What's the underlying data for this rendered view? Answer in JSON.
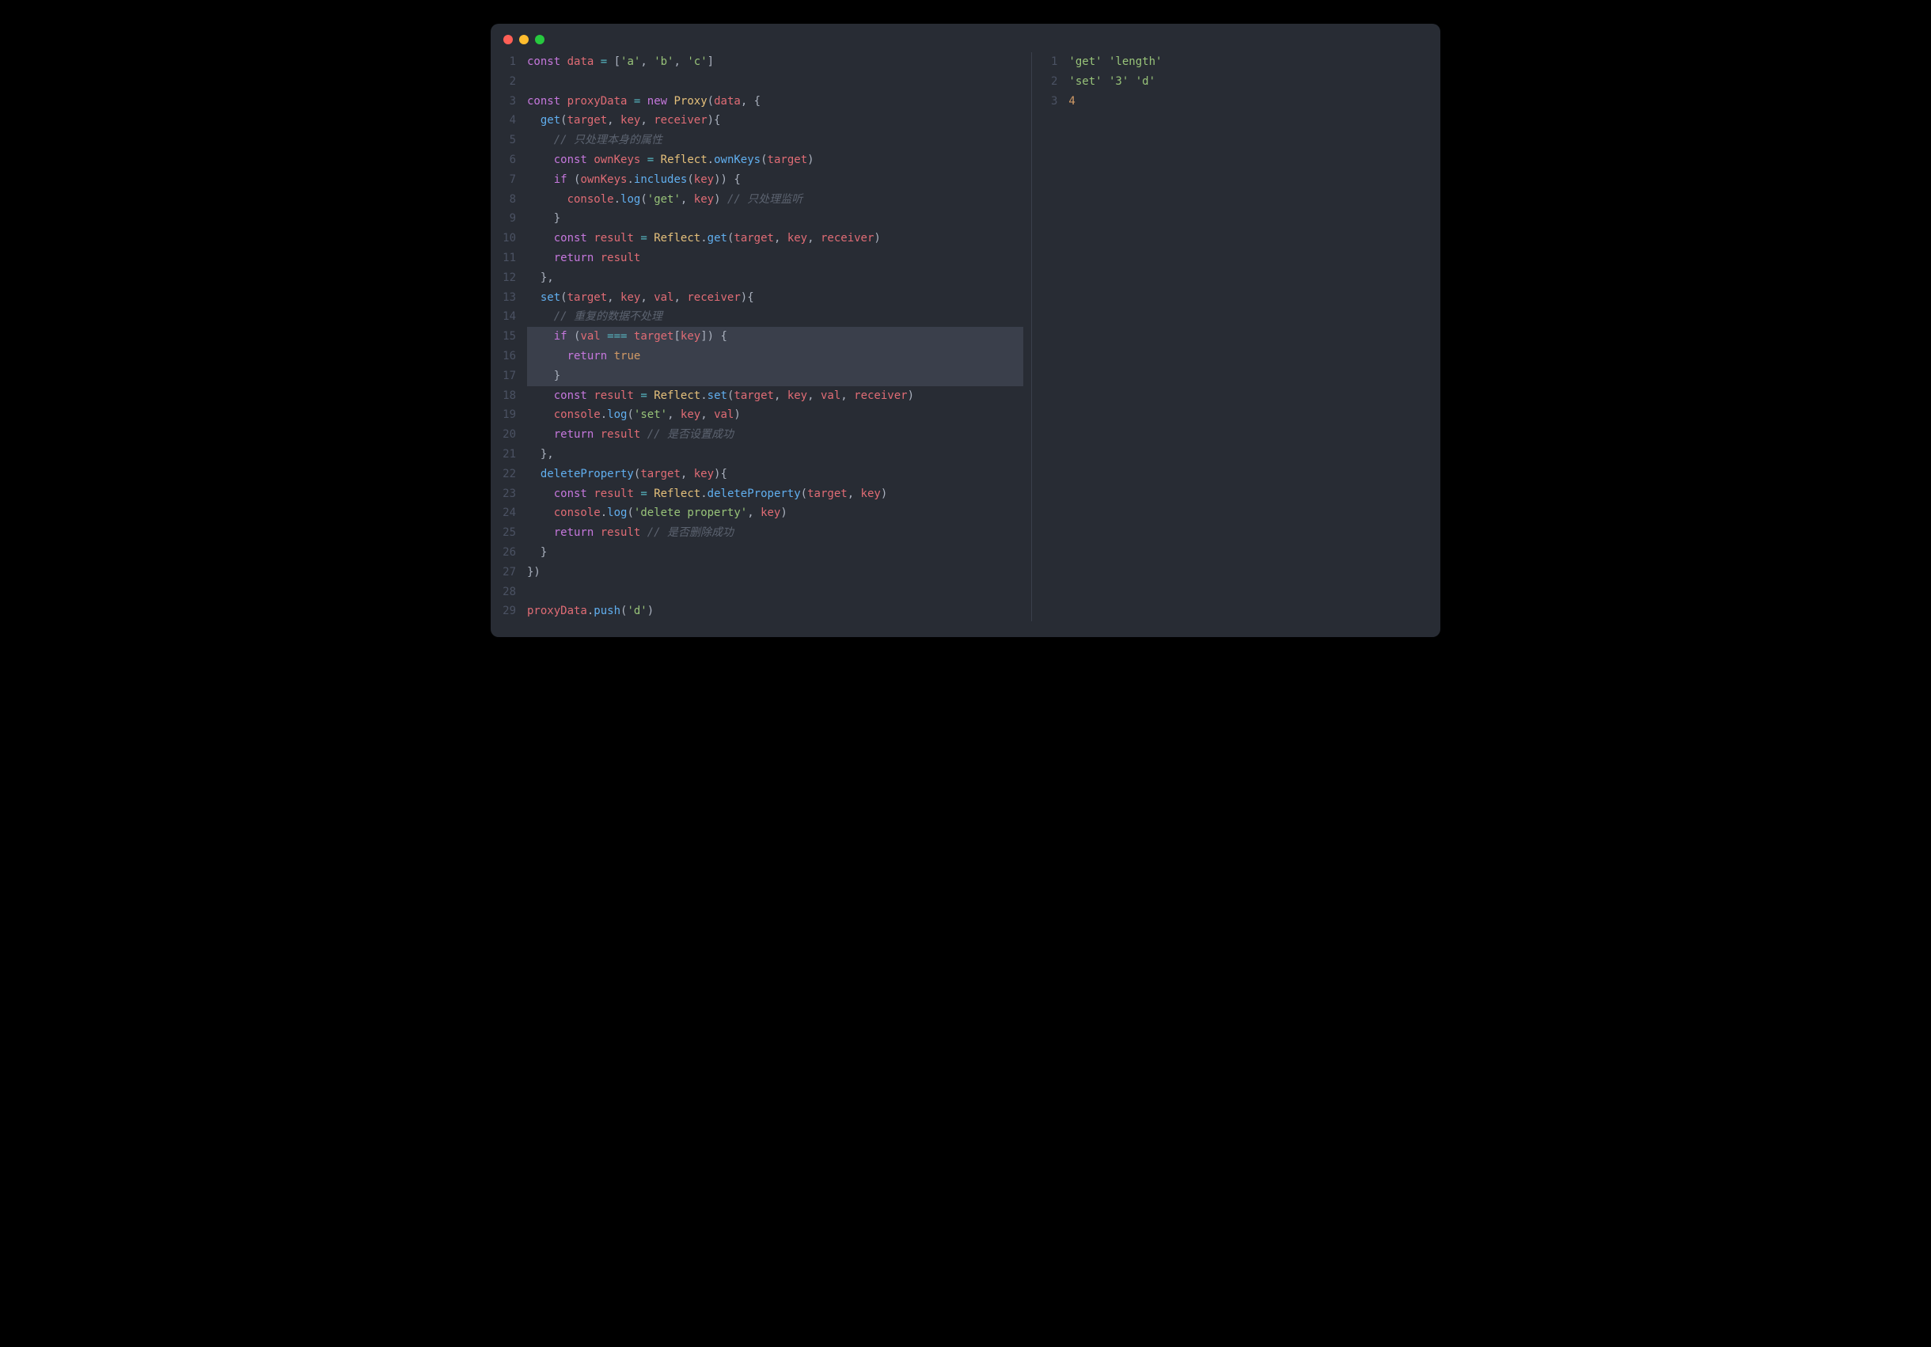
{
  "window": {
    "traffic": [
      "close",
      "minimize",
      "maximize"
    ]
  },
  "left": {
    "lines": [
      {
        "n": 1,
        "tokens": [
          [
            "kw",
            "const"
          ],
          [
            "pun",
            " "
          ],
          [
            "var",
            "data"
          ],
          [
            "pun",
            " "
          ],
          [
            "op",
            "="
          ],
          [
            "pun",
            " ["
          ],
          [
            "str",
            "'a'"
          ],
          [
            "pun",
            ", "
          ],
          [
            "str",
            "'b'"
          ],
          [
            "pun",
            ", "
          ],
          [
            "str",
            "'c'"
          ],
          [
            "pun",
            "]"
          ]
        ]
      },
      {
        "n": 2,
        "tokens": []
      },
      {
        "n": 3,
        "tokens": [
          [
            "kw",
            "const"
          ],
          [
            "pun",
            " "
          ],
          [
            "var",
            "proxyData"
          ],
          [
            "pun",
            " "
          ],
          [
            "op",
            "="
          ],
          [
            "pun",
            " "
          ],
          [
            "kw",
            "new"
          ],
          [
            "pun",
            " "
          ],
          [
            "cls",
            "Proxy"
          ],
          [
            "pun",
            "("
          ],
          [
            "var",
            "data"
          ],
          [
            "pun",
            ", {"
          ]
        ]
      },
      {
        "n": 4,
        "tokens": [
          [
            "pun",
            "  "
          ],
          [
            "fn",
            "get"
          ],
          [
            "pun",
            "("
          ],
          [
            "var",
            "target"
          ],
          [
            "pun",
            ", "
          ],
          [
            "var",
            "key"
          ],
          [
            "pun",
            ", "
          ],
          [
            "var",
            "receiver"
          ],
          [
            "pun",
            "){"
          ]
        ]
      },
      {
        "n": 5,
        "tokens": [
          [
            "pun",
            "    "
          ],
          [
            "cmt",
            "// 只处理本身的属性"
          ]
        ]
      },
      {
        "n": 6,
        "tokens": [
          [
            "pun",
            "    "
          ],
          [
            "kw",
            "const"
          ],
          [
            "pun",
            " "
          ],
          [
            "var",
            "ownKeys"
          ],
          [
            "pun",
            " "
          ],
          [
            "op",
            "="
          ],
          [
            "pun",
            " "
          ],
          [
            "cls",
            "Reflect"
          ],
          [
            "pun",
            "."
          ],
          [
            "fn",
            "ownKeys"
          ],
          [
            "pun",
            "("
          ],
          [
            "var",
            "target"
          ],
          [
            "pun",
            ")"
          ]
        ]
      },
      {
        "n": 7,
        "tokens": [
          [
            "pun",
            "    "
          ],
          [
            "kw",
            "if"
          ],
          [
            "pun",
            " ("
          ],
          [
            "var",
            "ownKeys"
          ],
          [
            "pun",
            "."
          ],
          [
            "fn",
            "includes"
          ],
          [
            "pun",
            "("
          ],
          [
            "var",
            "key"
          ],
          [
            "pun",
            ")) {"
          ]
        ]
      },
      {
        "n": 8,
        "tokens": [
          [
            "pun",
            "      "
          ],
          [
            "var",
            "console"
          ],
          [
            "pun",
            "."
          ],
          [
            "fn",
            "log"
          ],
          [
            "pun",
            "("
          ],
          [
            "str",
            "'get'"
          ],
          [
            "pun",
            ", "
          ],
          [
            "var",
            "key"
          ],
          [
            "pun",
            ") "
          ],
          [
            "cmt",
            "// 只处理监听"
          ]
        ]
      },
      {
        "n": 9,
        "tokens": [
          [
            "pun",
            "    }"
          ]
        ]
      },
      {
        "n": 10,
        "tokens": [
          [
            "pun",
            "    "
          ],
          [
            "kw",
            "const"
          ],
          [
            "pun",
            " "
          ],
          [
            "var",
            "result"
          ],
          [
            "pun",
            " "
          ],
          [
            "op",
            "="
          ],
          [
            "pun",
            " "
          ],
          [
            "cls",
            "Reflect"
          ],
          [
            "pun",
            "."
          ],
          [
            "fn",
            "get"
          ],
          [
            "pun",
            "("
          ],
          [
            "var",
            "target"
          ],
          [
            "pun",
            ", "
          ],
          [
            "var",
            "key"
          ],
          [
            "pun",
            ", "
          ],
          [
            "var",
            "receiver"
          ],
          [
            "pun",
            ")"
          ]
        ]
      },
      {
        "n": 11,
        "tokens": [
          [
            "pun",
            "    "
          ],
          [
            "kw",
            "return"
          ],
          [
            "pun",
            " "
          ],
          [
            "var",
            "result"
          ]
        ]
      },
      {
        "n": 12,
        "tokens": [
          [
            "pun",
            "  },"
          ]
        ]
      },
      {
        "n": 13,
        "tokens": [
          [
            "pun",
            "  "
          ],
          [
            "fn",
            "set"
          ],
          [
            "pun",
            "("
          ],
          [
            "var",
            "target"
          ],
          [
            "pun",
            ", "
          ],
          [
            "var",
            "key"
          ],
          [
            "pun",
            ", "
          ],
          [
            "var",
            "val"
          ],
          [
            "pun",
            ", "
          ],
          [
            "var",
            "receiver"
          ],
          [
            "pun",
            "){"
          ]
        ]
      },
      {
        "n": 14,
        "tokens": [
          [
            "pun",
            "    "
          ],
          [
            "cmt",
            "// 重复的数据不处理"
          ]
        ]
      },
      {
        "n": 15,
        "hl": true,
        "tokens": [
          [
            "pun",
            "    "
          ],
          [
            "kw",
            "if"
          ],
          [
            "pun",
            " ("
          ],
          [
            "var",
            "val"
          ],
          [
            "pun",
            " "
          ],
          [
            "op",
            "==="
          ],
          [
            "pun",
            " "
          ],
          [
            "var",
            "target"
          ],
          [
            "pun",
            "["
          ],
          [
            "var",
            "key"
          ],
          [
            "pun",
            "]) {"
          ]
        ]
      },
      {
        "n": 16,
        "hl": true,
        "tokens": [
          [
            "pun",
            "      "
          ],
          [
            "kw",
            "return"
          ],
          [
            "pun",
            " "
          ],
          [
            "bool",
            "true"
          ]
        ]
      },
      {
        "n": 17,
        "hl": true,
        "tokens": [
          [
            "pun",
            "    }"
          ]
        ]
      },
      {
        "n": 18,
        "tokens": [
          [
            "pun",
            "    "
          ],
          [
            "kw",
            "const"
          ],
          [
            "pun",
            " "
          ],
          [
            "var",
            "result"
          ],
          [
            "pun",
            " "
          ],
          [
            "op",
            "="
          ],
          [
            "pun",
            " "
          ],
          [
            "cls",
            "Reflect"
          ],
          [
            "pun",
            "."
          ],
          [
            "fn",
            "set"
          ],
          [
            "pun",
            "("
          ],
          [
            "var",
            "target"
          ],
          [
            "pun",
            ", "
          ],
          [
            "var",
            "key"
          ],
          [
            "pun",
            ", "
          ],
          [
            "var",
            "val"
          ],
          [
            "pun",
            ", "
          ],
          [
            "var",
            "receiver"
          ],
          [
            "pun",
            ")"
          ]
        ]
      },
      {
        "n": 19,
        "tokens": [
          [
            "pun",
            "    "
          ],
          [
            "var",
            "console"
          ],
          [
            "pun",
            "."
          ],
          [
            "fn",
            "log"
          ],
          [
            "pun",
            "("
          ],
          [
            "str",
            "'set'"
          ],
          [
            "pun",
            ", "
          ],
          [
            "var",
            "key"
          ],
          [
            "pun",
            ", "
          ],
          [
            "var",
            "val"
          ],
          [
            "pun",
            ")"
          ]
        ]
      },
      {
        "n": 20,
        "tokens": [
          [
            "pun",
            "    "
          ],
          [
            "kw",
            "return"
          ],
          [
            "pun",
            " "
          ],
          [
            "var",
            "result"
          ],
          [
            "pun",
            " "
          ],
          [
            "cmt",
            "// 是否设置成功"
          ]
        ]
      },
      {
        "n": 21,
        "tokens": [
          [
            "pun",
            "  },"
          ]
        ]
      },
      {
        "n": 22,
        "tokens": [
          [
            "pun",
            "  "
          ],
          [
            "fn",
            "deleteProperty"
          ],
          [
            "pun",
            "("
          ],
          [
            "var",
            "target"
          ],
          [
            "pun",
            ", "
          ],
          [
            "var",
            "key"
          ],
          [
            "pun",
            "){"
          ]
        ]
      },
      {
        "n": 23,
        "tokens": [
          [
            "pun",
            "    "
          ],
          [
            "kw",
            "const"
          ],
          [
            "pun",
            " "
          ],
          [
            "var",
            "result"
          ],
          [
            "pun",
            " "
          ],
          [
            "op",
            "="
          ],
          [
            "pun",
            " "
          ],
          [
            "cls",
            "Reflect"
          ],
          [
            "pun",
            "."
          ],
          [
            "fn",
            "deleteProperty"
          ],
          [
            "pun",
            "("
          ],
          [
            "var",
            "target"
          ],
          [
            "pun",
            ", "
          ],
          [
            "var",
            "key"
          ],
          [
            "pun",
            ")"
          ]
        ]
      },
      {
        "n": 24,
        "tokens": [
          [
            "pun",
            "    "
          ],
          [
            "var",
            "console"
          ],
          [
            "pun",
            "."
          ],
          [
            "fn",
            "log"
          ],
          [
            "pun",
            "("
          ],
          [
            "str",
            "'delete property'"
          ],
          [
            "pun",
            ", "
          ],
          [
            "var",
            "key"
          ],
          [
            "pun",
            ")"
          ]
        ]
      },
      {
        "n": 25,
        "tokens": [
          [
            "pun",
            "    "
          ],
          [
            "kw",
            "return"
          ],
          [
            "pun",
            " "
          ],
          [
            "var",
            "result"
          ],
          [
            "pun",
            " "
          ],
          [
            "cmt",
            "// 是否删除成功"
          ]
        ]
      },
      {
        "n": 26,
        "tokens": [
          [
            "pun",
            "  }"
          ]
        ]
      },
      {
        "n": 27,
        "tokens": [
          [
            "pun",
            "})"
          ]
        ]
      },
      {
        "n": 28,
        "tokens": []
      },
      {
        "n": 29,
        "tokens": [
          [
            "var",
            "proxyData"
          ],
          [
            "pun",
            "."
          ],
          [
            "fn",
            "push"
          ],
          [
            "pun",
            "("
          ],
          [
            "str",
            "'d'"
          ],
          [
            "pun",
            ")"
          ]
        ]
      }
    ]
  },
  "right": {
    "lines": [
      {
        "n": 1,
        "tokens": [
          [
            "str",
            "'get'"
          ],
          [
            "pun",
            " "
          ],
          [
            "str",
            "'length'"
          ]
        ]
      },
      {
        "n": 2,
        "tokens": [
          [
            "str",
            "'set'"
          ],
          [
            "pun",
            " "
          ],
          [
            "str",
            "'3'"
          ],
          [
            "pun",
            " "
          ],
          [
            "str",
            "'d'"
          ]
        ]
      },
      {
        "n": 3,
        "tokens": [
          [
            "num",
            "4"
          ]
        ]
      }
    ]
  }
}
